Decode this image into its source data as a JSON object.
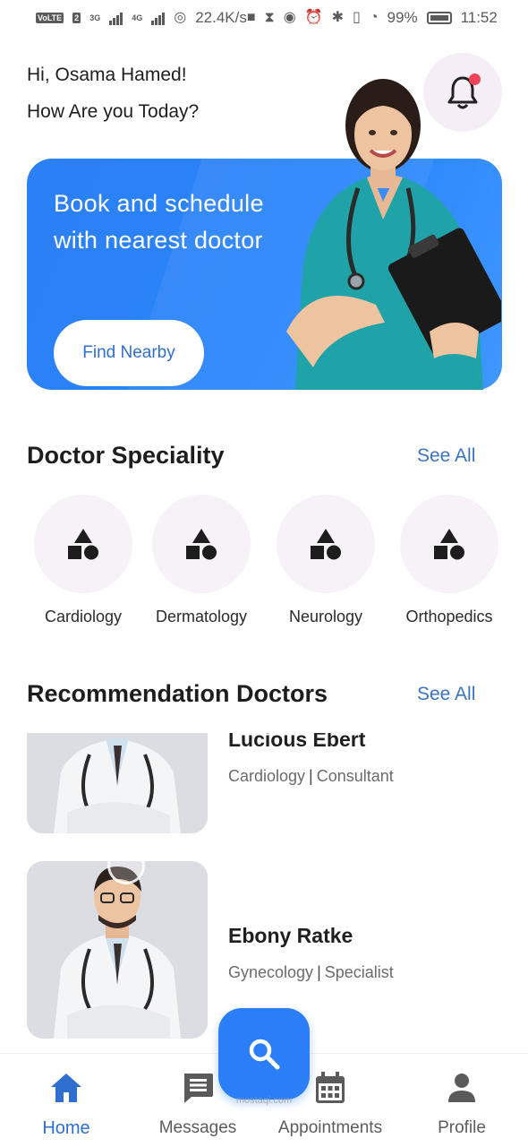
{
  "status_bar": {
    "volte": "VoLTE",
    "sim": "2",
    "net1": "3G",
    "net2": "4G",
    "speed": "22.4K/s",
    "battery": "99%",
    "time": "11:52"
  },
  "greeting": {
    "line1": "Hi, Osama Hamed!",
    "line2": "How Are you Today?"
  },
  "banner": {
    "title": "Book and schedule with nearest doctor",
    "button_label": "Find Nearby"
  },
  "speciality": {
    "title": "Doctor Speciality",
    "see_all": "See All",
    "items": [
      {
        "label": "Cardiology",
        "icon": "category-shapes-icon"
      },
      {
        "label": "Dermatology",
        "icon": "category-shapes-icon"
      },
      {
        "label": "Neurology",
        "icon": "category-shapes-icon"
      },
      {
        "label": "Orthopedics",
        "icon": "category-shapes-icon"
      }
    ]
  },
  "recommendations": {
    "title": "Recommendation Doctors",
    "see_all": "See All",
    "doctors": [
      {
        "name": "Lucious Ebert",
        "specialty": "Cardiology",
        "rank": "Consultant"
      },
      {
        "name": "Ebony Ratke",
        "specialty": "Gynecology",
        "rank": "Specialist"
      }
    ]
  },
  "nav": {
    "items": [
      {
        "label": "Home",
        "icon": "home-icon",
        "active": true
      },
      {
        "label": "Messages",
        "icon": "message-icon",
        "active": false
      },
      {
        "label": "Appointments",
        "icon": "calendar-icon",
        "active": false
      },
      {
        "label": "Profile",
        "icon": "person-icon",
        "active": false
      }
    ],
    "fab_icon": "search-icon",
    "watermark": "mostaql.com"
  },
  "colors": {
    "primary": "#2B7EF8",
    "link": "#3B74C4",
    "notification_dot": "#F0435A",
    "soft_bg": "#F7F1F8"
  }
}
